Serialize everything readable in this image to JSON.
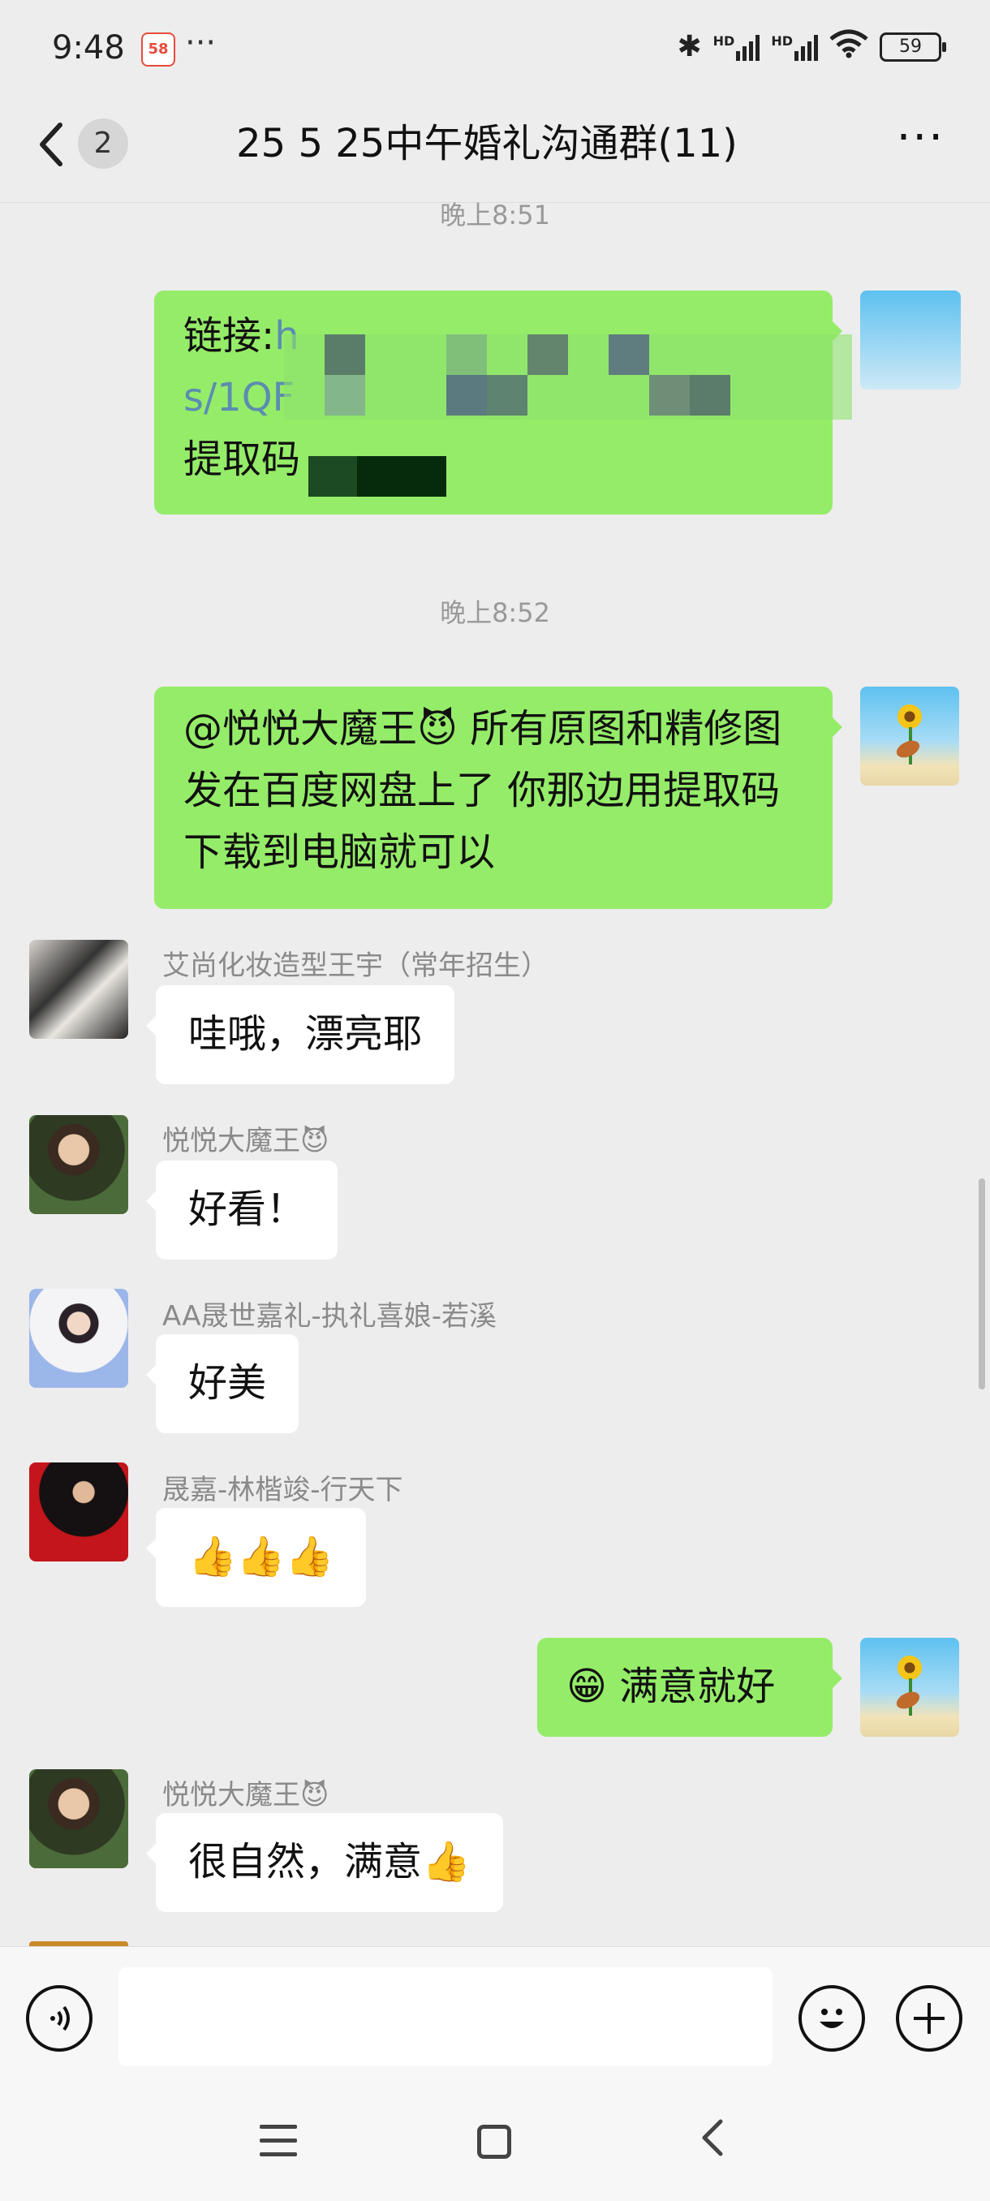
{
  "status_bar": {
    "time": "9:48",
    "app_badge": "58",
    "more": "···",
    "net_hd_1": "HD",
    "net_hd_2": "HD",
    "battery": "59"
  },
  "header": {
    "back_badge": "2",
    "title": "25 5 25中午婚礼沟通群(11)",
    "more_label": "···"
  },
  "messages": {
    "ts1": "晚上8:51",
    "link_label": "链接:",
    "link_line1_visible": "h",
    "link_line2_visible": "s/1QF",
    "extract_label": "提取码",
    "ts2": "晚上8:52",
    "msg_notice": "@悦悦大魔王😈  所有原图和精修图 发在百度网盘上了 你那边用提取码下载到电脑就可以",
    "sender_1": "艾尚化妆造型王宇（常年招生）",
    "msg_1": "哇哦，漂亮耶",
    "sender_2": "悦悦大魔王😈",
    "msg_2": "好看！",
    "sender_3": "AA晟世嘉礼-执礼喜娘-若溪",
    "msg_3": "好美",
    "sender_4": "晟嘉-林楷竣-行天下",
    "msg_4": "👍👍👍",
    "msg_me": "😁 满意就好",
    "sender_5": "悦悦大魔王😈",
    "msg_5": "很自然，满意👍"
  },
  "input": {
    "placeholder": ""
  },
  "colors": {
    "my_bubble": "#95ec69",
    "other_bubble": "#ffffff",
    "background": "#ededed"
  },
  "icons": [
    "back-arrow-icon",
    "more-icon",
    "voice-icon",
    "emoji-icon",
    "plus-icon",
    "menu-icon",
    "home-icon",
    "nav-back-icon"
  ]
}
